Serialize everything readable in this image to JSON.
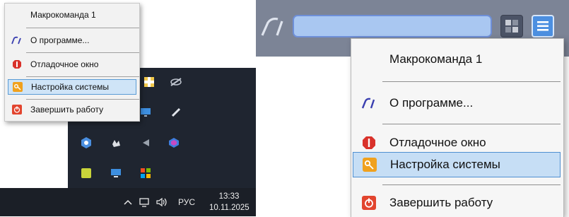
{
  "context_menu": {
    "items": [
      {
        "label": "Макрокоманда 1",
        "icon": ""
      },
      {
        "label": "О программе...",
        "icon": "app-logo-icon"
      },
      {
        "label": "Отладочное окно",
        "icon": "debug-stop-icon"
      },
      {
        "label": "Настройка системы",
        "icon": "key-settings-icon",
        "selected": true
      },
      {
        "label": "Завершить работу",
        "icon": "power-off-icon"
      }
    ]
  },
  "taskbar": {
    "language": "РУС",
    "time": "13:33",
    "date": "10.11.2025"
  },
  "colors": {
    "selection": "#cfe4f7",
    "selection_border": "#5a9bd5",
    "header": "#7c8496",
    "search_fill": "#a9c7f1",
    "taskbar": "#1b1f27"
  }
}
